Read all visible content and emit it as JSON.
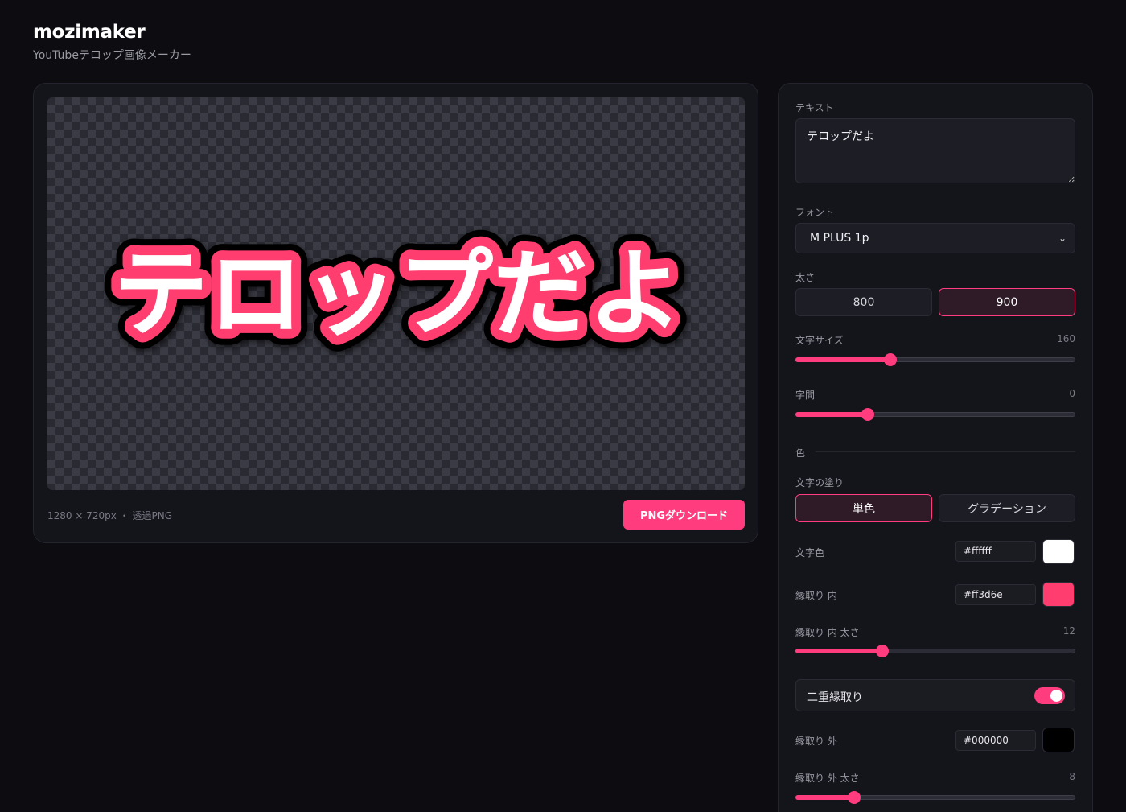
{
  "app": {
    "title": "mozimaker",
    "subtitle": "YouTubeテロップ画像メーカー"
  },
  "preview": {
    "text": "テロップだよ",
    "info": "1280 × 720px ・ 透過PNG",
    "download_label": "PNGダウンロード"
  },
  "settings": {
    "text_label": "テキスト",
    "text_value": "テロップだよ",
    "font_label": "フォント",
    "font_value": "M PLUS 1p",
    "weight_label": "太さ",
    "weight_options": [
      "800",
      "900"
    ],
    "weight_selected": "900",
    "size_label": "文字サイズ",
    "size_value": "160",
    "size_fraction": 0.34,
    "spacing_label": "字間",
    "spacing_value": "0",
    "spacing_fraction": 0.26,
    "color_section": "色",
    "fill_label": "文字の塗り",
    "fill_options": [
      "単色",
      "グラデーション"
    ],
    "fill_selected": "単色",
    "text_color_label": "文字色",
    "text_color": "#ffffff",
    "inner_stroke_label": "縁取り 内",
    "inner_stroke_color": "#ff3d6e",
    "inner_width_label": "縁取り 内 太さ",
    "inner_width_value": "12",
    "inner_width_fraction": 0.31,
    "double_stroke_label": "二重縁取り",
    "double_stroke_on": true,
    "outer_stroke_label": "縁取り 外",
    "outer_stroke_color": "#000000",
    "outer_width_label": "縁取り 外 太さ",
    "outer_width_value": "8",
    "outer_width_fraction": 0.21
  },
  "colors": {
    "accent": "#ff3d7e",
    "background": "#0c0c11"
  }
}
